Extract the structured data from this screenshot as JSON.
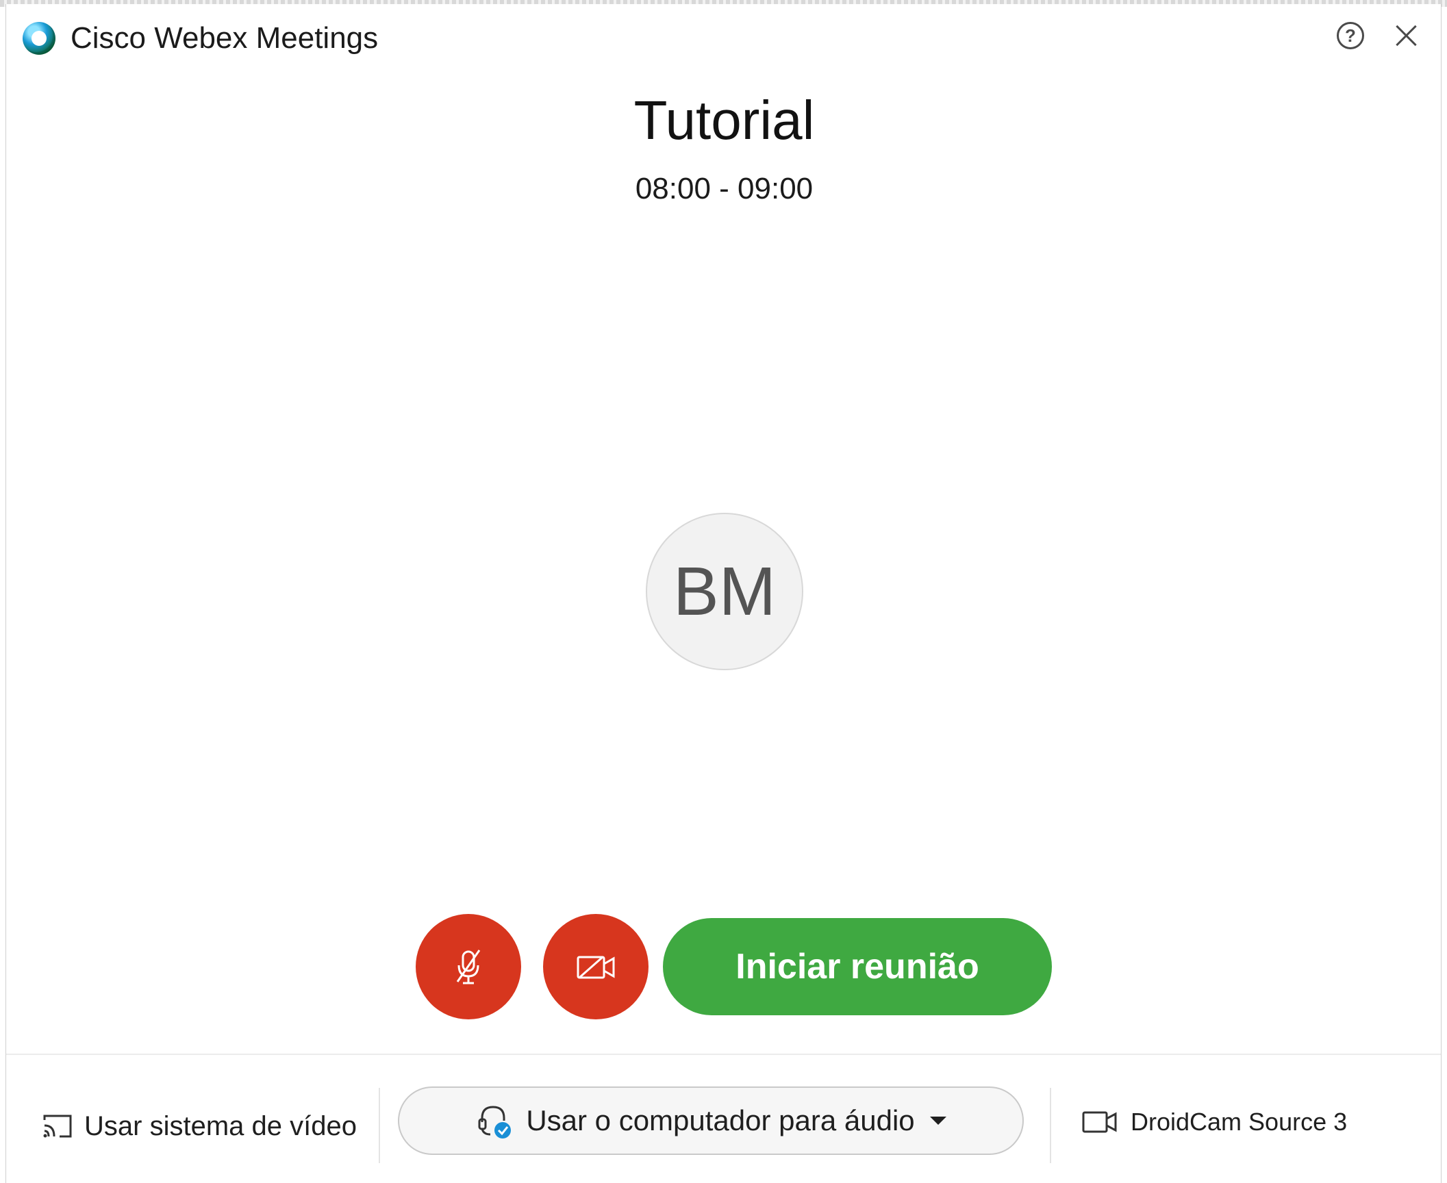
{
  "window": {
    "title": "Cisco Webex Meetings",
    "help_glyph": "?"
  },
  "meeting": {
    "title": "Tutorial",
    "time": "08:00 - 09:00",
    "avatar_initials": "BM"
  },
  "controls": {
    "start_label": "Iniciar reunião",
    "mute_state": "muted",
    "video_state": "off"
  },
  "footer": {
    "video_system_label": "Usar sistema de vídeo",
    "audio_label": "Usar o computador para áudio",
    "camera_label": "DroidCam Source 3"
  },
  "colors": {
    "danger": "#d7361e",
    "start": "#3fa941",
    "audio_check": "#1a8fd6"
  },
  "icons": {
    "app": "webex-logo-icon",
    "help": "help-icon",
    "close": "close-icon",
    "mute": "microphone-muted-icon",
    "video": "camera-off-icon",
    "cast": "cast-icon",
    "headset": "headset-check-icon",
    "dropdown": "caret-down-icon",
    "camera": "camera-icon"
  }
}
